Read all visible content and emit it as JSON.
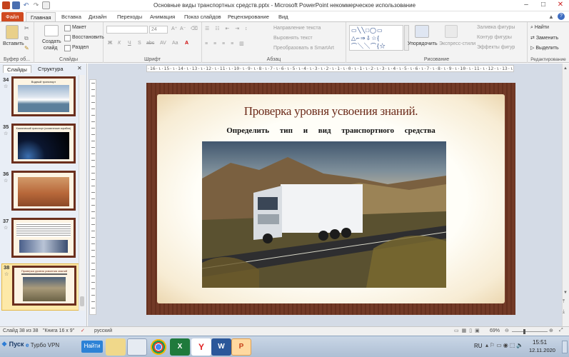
{
  "window": {
    "title": "Основные виды транспортных средств.pptx - Microsoft PowerPoint некоммерческое использование",
    "controls": {
      "minimize": "–",
      "maximize": "□",
      "close": "✕"
    }
  },
  "ribbon_tabs": [
    "Файл",
    "Главная",
    "Вставка",
    "Дизайн",
    "Переходы",
    "Анимация",
    "Показ слайдов",
    "Рецензирование",
    "Вид"
  ],
  "ribbon": {
    "clipboard": {
      "paste": "Вставить",
      "group_label": "Буфер об..."
    },
    "slides": {
      "new_slide_line1": "Создать",
      "new_slide_line2": "слайд",
      "layout": "Макет",
      "reset": "Восстановить",
      "section": "Раздел",
      "group_label": "Слайды"
    },
    "font": {
      "size": "24",
      "bold": "Ж",
      "italic": "К",
      "underline": "Ч",
      "strike": "S",
      "spacing": "AV",
      "case": "Aa",
      "color": "A",
      "group_label": "Шрифт"
    },
    "paragraph": {
      "text_direction": "Направление текста",
      "align_text": "Выровнять текст",
      "smartart": "Преобразовать в SmartArt",
      "group_label": "Абзац"
    },
    "drawing": {
      "arrange": "Упорядочить",
      "quick_styles": "Экспресс-стили",
      "fill": "Заливка фигуры",
      "outline": "Контур фигуры",
      "effects": "Эффекты фигур",
      "group_label": "Рисование"
    },
    "editing": {
      "find": "Найти",
      "replace": "Заменить",
      "select": "Выделить",
      "group_label": "Редактирование"
    }
  },
  "left_pane": {
    "tabs": [
      "Слайды",
      "Структура"
    ],
    "close": "✕",
    "thumbnails": [
      {
        "num": "34",
        "caption": "Водный транспорт"
      },
      {
        "num": "35",
        "caption": "Космический транспорт (космические корабли)"
      },
      {
        "num": "36",
        "caption": ""
      },
      {
        "num": "37",
        "caption": ""
      },
      {
        "num": "38",
        "caption": "Проверка уровня усвоения знаний"
      }
    ]
  },
  "ruler": {
    "horizontal": "·16·ι·15·ι·14·ι·13·ι·12·ι·11·ι·10·ι·9·ι·8·ι·7·ι·6·ι·5·ι·4·ι·3·ι·2·ι·1·ι·0·ι·1·ι·2·ι·3·ι·4·ι·5·ι·6·ι·7·ι·8·ι·9·ι·10·ι·11·ι·12·ι·13·ι·14·ι·15·ι·16·"
  },
  "slide": {
    "title": "Проверка уровня усвоения знаний.",
    "subtitle": "Определить тип и вид транспортного средства"
  },
  "statusbar": {
    "slide_info": "Слайд 38 из 38",
    "theme": "\"Книга 16 x 9\"",
    "language": "русский",
    "zoom": "69%"
  },
  "taskbar": {
    "start": "Пуск",
    "vpn": "Турбо VPN",
    "search_button": "Найти",
    "lang": "RU",
    "time": "15:51",
    "date": "12.11.2020"
  }
}
